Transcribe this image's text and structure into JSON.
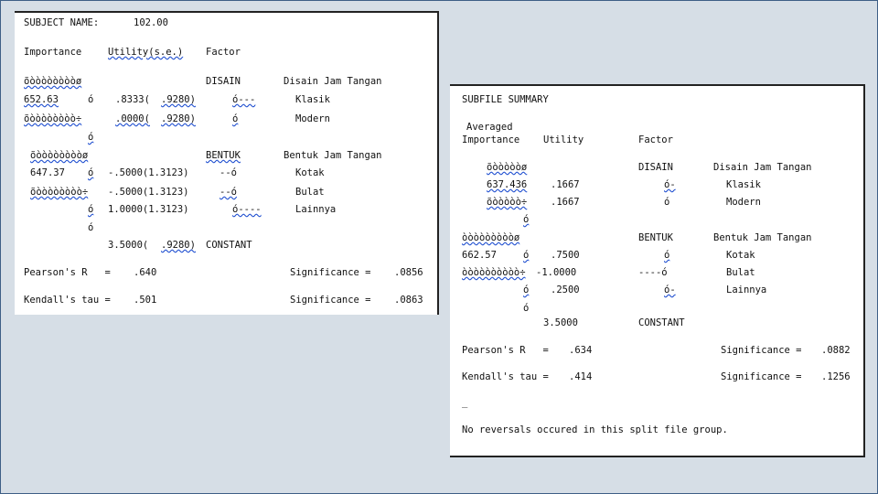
{
  "panel1": {
    "subject_label": "SUBJECT NAME:",
    "subject_value": "102.00",
    "hdr_importance": "Importance",
    "hdr_utility": "Utility(s.e.)",
    "hdr_factor": "Factor",
    "bar1_top": "õòòòòòòòòø",
    "disain": "DISAIN",
    "disain_desc": "Disain Jam Tangan",
    "imp_disain": "652.63",
    "glyph_a": "ó",
    "u_klasik": ".8333(",
    "se_klasik": ".9280)",
    "mark_klasik": "ó---",
    "klasik": "Klasik",
    "bar1_bottom": "õòòòòòòòò÷",
    "u_modern": ".0000(",
    "se_modern": ".9280)",
    "mark_modern": "ó",
    "modern": "Modern",
    "glyph_b": "ó",
    "bar2_top": "õòòòòòòòòø",
    "bentuk": "BENTUK",
    "bentuk_desc": "Bentuk Jam Tangan",
    "imp_bentuk": "647.37",
    "glyph_c": "ó",
    "u_kotak": "-.5000(1.3123)",
    "mark_kotak": "--ó",
    "kotak": "Kotak",
    "bar2_bottom": "õòòòòòòòò÷",
    "u_bulat": "-.5000(1.3123)",
    "mark_bulat": "--ó",
    "bulat": "Bulat",
    "glyph_d": "ó",
    "u_lainnya": "1.0000(1.3123)",
    "mark_lainnya": "ó----",
    "lainnya": "Lainnya",
    "glyph_e": "ó",
    "u_constant": "3.5000(",
    "se_constant": ".9280)",
    "constant": "CONSTANT",
    "pearson_label": "Pearson's R   =",
    "pearson_value": ".640",
    "pearson_sig_label": "Significance =",
    "pearson_sig": ".0856",
    "kendall_label": "Kendall's tau =",
    "kendall_value": ".501",
    "kendall_sig_label": "Significance =",
    "kendall_sig": ".0863"
  },
  "panel2": {
    "title": "SUBFILE SUMMARY",
    "hdr_averaged": "Averaged",
    "hdr_importance": "Importance",
    "hdr_utility": "Utility",
    "hdr_factor": "Factor",
    "bar1_top": "õòòòòòø",
    "disain": "DISAIN",
    "disain_desc": "Disain Jam Tangan",
    "imp_disain": "637.436",
    "u_klasik": ".1667",
    "mark_klasik": "ó-",
    "klasik": "Klasik",
    "bar1_bottom": "õòòòòò÷",
    "u_modern": ".1667",
    "mark_modern": "ó",
    "modern": "Modern",
    "glyph_a": "ó",
    "bar2_top": "òòòòòòòòòø",
    "bentuk": "BENTUK",
    "bentuk_desc": "Bentuk Jam Tangan",
    "imp_bentuk": "662.57",
    "glyph_b": "ó",
    "u_kotak": ".7500",
    "mark_kotak": "ó",
    "kotak": "Kotak",
    "bar2_bottom": "òòòòòòòòòò÷",
    "u_bulat": "-1.0000",
    "mark_bulat": "----ó",
    "bulat": "Bulat",
    "glyph_c": "ó",
    "u_lainnya": ".2500",
    "mark_lainnya": "ó-",
    "lainnya": "Lainnya",
    "glyph_d": "ó",
    "u_constant": "3.5000",
    "constant": "CONSTANT",
    "pearson_label": "Pearson's R   =",
    "pearson_value": ".634",
    "pearson_sig_label": "Significance =",
    "pearson_sig": ".0882",
    "kendall_label": "Kendall's tau =",
    "kendall_value": ".414",
    "kendall_sig_label": "Significance =",
    "kendall_sig": ".1256",
    "dash": "_",
    "footer": "No reversals occured in this split file group."
  }
}
